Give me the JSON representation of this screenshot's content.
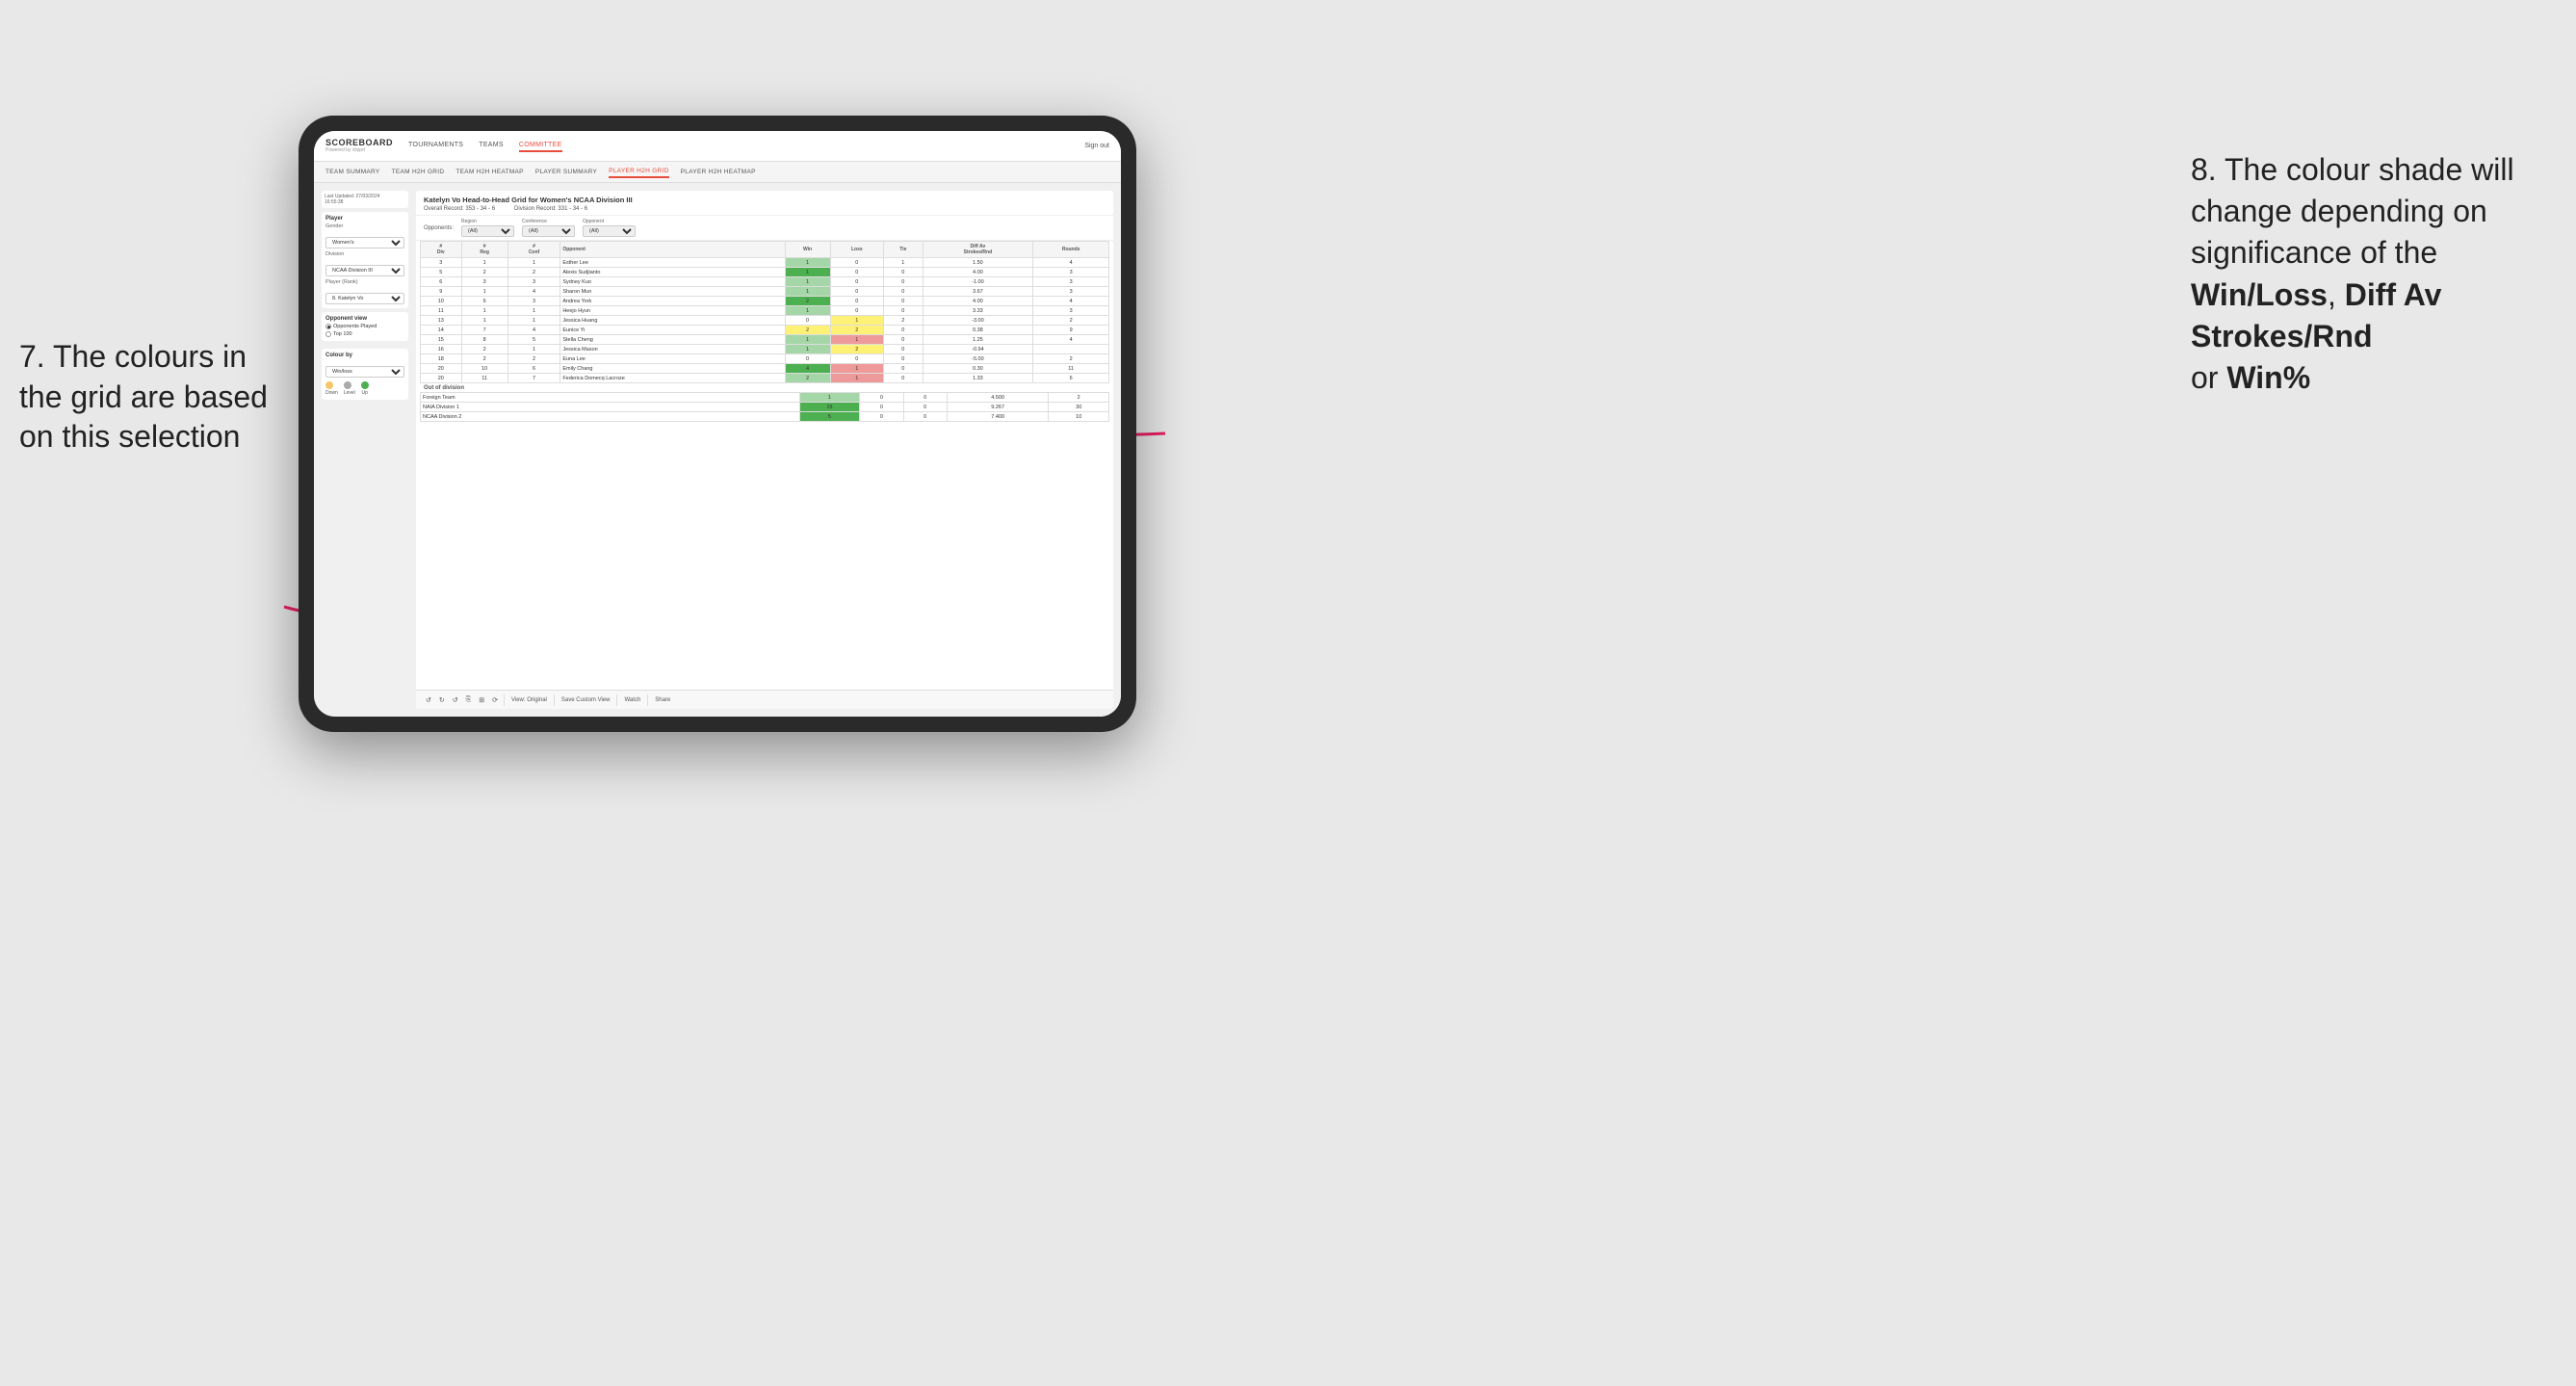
{
  "annotations": {
    "left_title": "7. The colours in the grid are based on this selection",
    "right_title": "8. The colour shade will change depending on significance of the",
    "right_bold1": "Win/Loss",
    "right_sep1": ", ",
    "right_bold2": "Diff Av Strokes/Rnd",
    "right_sep2": " or",
    "right_bold3": "Win%"
  },
  "nav": {
    "logo": "SCOREBOARD",
    "logo_sub": "Powered by clippd",
    "items": [
      "TOURNAMENTS",
      "TEAMS",
      "COMMITTEE"
    ],
    "active": "COMMITTEE",
    "sign_in": "Sign out"
  },
  "sub_nav": {
    "items": [
      "TEAM SUMMARY",
      "TEAM H2H GRID",
      "TEAM H2H HEATMAP",
      "PLAYER SUMMARY",
      "PLAYER H2H GRID",
      "PLAYER H2H HEATMAP"
    ],
    "active": "PLAYER H2H GRID"
  },
  "left_panel": {
    "last_updated_label": "Last Updated: 27/03/2024",
    "last_updated_time": "16:55:38",
    "player_label": "Player",
    "gender_label": "Gender",
    "gender_value": "Women's",
    "division_label": "Division",
    "division_value": "NCAA Division III",
    "player_rank_label": "Player (Rank)",
    "player_rank_value": "8. Katelyn Vo",
    "opponent_view_label": "Opponent view",
    "opponent_played": "Opponents Played",
    "opponent_top100": "Top 100",
    "colour_by_label": "Colour by",
    "colour_by_value": "Win/loss",
    "legend_down": "Down",
    "legend_level": "Level",
    "legend_up": "Up"
  },
  "grid": {
    "title": "Katelyn Vo Head-to-Head Grid for Women's NCAA Division III",
    "overall_record_label": "Overall Record:",
    "overall_record": "353 - 34 - 6",
    "division_record_label": "Division Record:",
    "division_record": "331 - 34 - 6",
    "filter_opponents": "Opponents:",
    "filter_region_label": "Region",
    "filter_region_value": "(All)",
    "filter_conference_label": "Conference",
    "filter_conference_value": "(All)",
    "filter_opponent_label": "Opponent",
    "filter_opponent_value": "(All)",
    "col_headers": [
      "#\nDiv",
      "#\nReg",
      "#\nConf",
      "Opponent",
      "Win",
      "Loss",
      "Tie",
      "Diff Av\nStrokes/Rnd",
      "Rounds"
    ],
    "rows": [
      {
        "div": 3,
        "reg": 1,
        "conf": 1,
        "opponent": "Esther Lee",
        "win": 1,
        "loss": 0,
        "tie": 1,
        "diff": "1.50",
        "rounds": 4,
        "win_color": "green_light",
        "loss_color": "none"
      },
      {
        "div": 5,
        "reg": 2,
        "conf": 2,
        "opponent": "Alexis Sudjianto",
        "win": 1,
        "loss": 0,
        "tie": 0,
        "diff": "4.00",
        "rounds": 3,
        "win_color": "green_dark",
        "loss_color": "none"
      },
      {
        "div": 6,
        "reg": 3,
        "conf": 3,
        "opponent": "Sydney Kuo",
        "win": 1,
        "loss": 0,
        "tie": 0,
        "diff": "-1.00",
        "rounds": 3,
        "win_color": "green_light",
        "loss_color": "none"
      },
      {
        "div": 9,
        "reg": 1,
        "conf": 4,
        "opponent": "Sharon Mun",
        "win": 1,
        "loss": 0,
        "tie": 0,
        "diff": "3.67",
        "rounds": 3,
        "win_color": "green_light",
        "loss_color": "none"
      },
      {
        "div": 10,
        "reg": 6,
        "conf": 3,
        "opponent": "Andrea York",
        "win": 2,
        "loss": 0,
        "tie": 0,
        "diff": "4.00",
        "rounds": 4,
        "win_color": "green_dark",
        "loss_color": "none"
      },
      {
        "div": 11,
        "reg": 1,
        "conf": 1,
        "opponent": "Heejo Hyun",
        "win": 1,
        "loss": 0,
        "tie": 0,
        "diff": "3.33",
        "rounds": 3,
        "win_color": "green_light",
        "loss_color": "none"
      },
      {
        "div": 13,
        "reg": 1,
        "conf": 1,
        "opponent": "Jessica Huang",
        "win": 0,
        "loss": 1,
        "tie": 2,
        "diff": "-3.00",
        "rounds": 2,
        "win_color": "none",
        "loss_color": "yellow"
      },
      {
        "div": 14,
        "reg": 7,
        "conf": 4,
        "opponent": "Eunice Yi",
        "win": 2,
        "loss": 2,
        "tie": 0,
        "diff": "0.38",
        "rounds": 9,
        "win_color": "yellow",
        "loss_color": "yellow"
      },
      {
        "div": 15,
        "reg": 8,
        "conf": 5,
        "opponent": "Stella Cheng",
        "win": 1,
        "loss": 1,
        "tie": 0,
        "diff": "1.25",
        "rounds": 4,
        "win_color": "green_light",
        "loss_color": "red_light"
      },
      {
        "div": 16,
        "reg": 2,
        "conf": 1,
        "opponent": "Jessica Mason",
        "win": 1,
        "loss": 2,
        "tie": 0,
        "diff": "-0.94",
        "rounds": "",
        "win_color": "green_light",
        "loss_color": "yellow"
      },
      {
        "div": 18,
        "reg": 2,
        "conf": 2,
        "opponent": "Euna Lee",
        "win": 0,
        "loss": 0,
        "tie": 0,
        "diff": "-5.00",
        "rounds": 2,
        "win_color": "none",
        "loss_color": "none"
      },
      {
        "div": 20,
        "reg": 10,
        "conf": 6,
        "opponent": "Emily Chang",
        "win": 4,
        "loss": 1,
        "tie": 0,
        "diff": "0.30",
        "rounds": 11,
        "win_color": "green_dark",
        "loss_color": "red_light"
      },
      {
        "div": 20,
        "reg": 11,
        "conf": 7,
        "opponent": "Federica Domecq Lacroze",
        "win": 2,
        "loss": 1,
        "tie": 0,
        "diff": "1.33",
        "rounds": 6,
        "win_color": "green_light",
        "loss_color": "red_light"
      }
    ],
    "out_of_division_label": "Out of division",
    "out_of_division_rows": [
      {
        "name": "Foreign Team",
        "win": 1,
        "loss": 0,
        "tie": 0,
        "diff": "4.500",
        "rounds": 2,
        "win_color": "green_light"
      },
      {
        "name": "NAIA Division 1",
        "win": 15,
        "loss": 0,
        "tie": 0,
        "diff": "9.267",
        "rounds": 30,
        "win_color": "green_dark"
      },
      {
        "name": "NCAA Division 2",
        "win": 5,
        "loss": 0,
        "tie": 0,
        "diff": "7.400",
        "rounds": 10,
        "win_color": "green_dark"
      }
    ]
  },
  "toolbar": {
    "view_original": "View: Original",
    "save_custom": "Save Custom View",
    "watch": "Watch",
    "share": "Share"
  }
}
